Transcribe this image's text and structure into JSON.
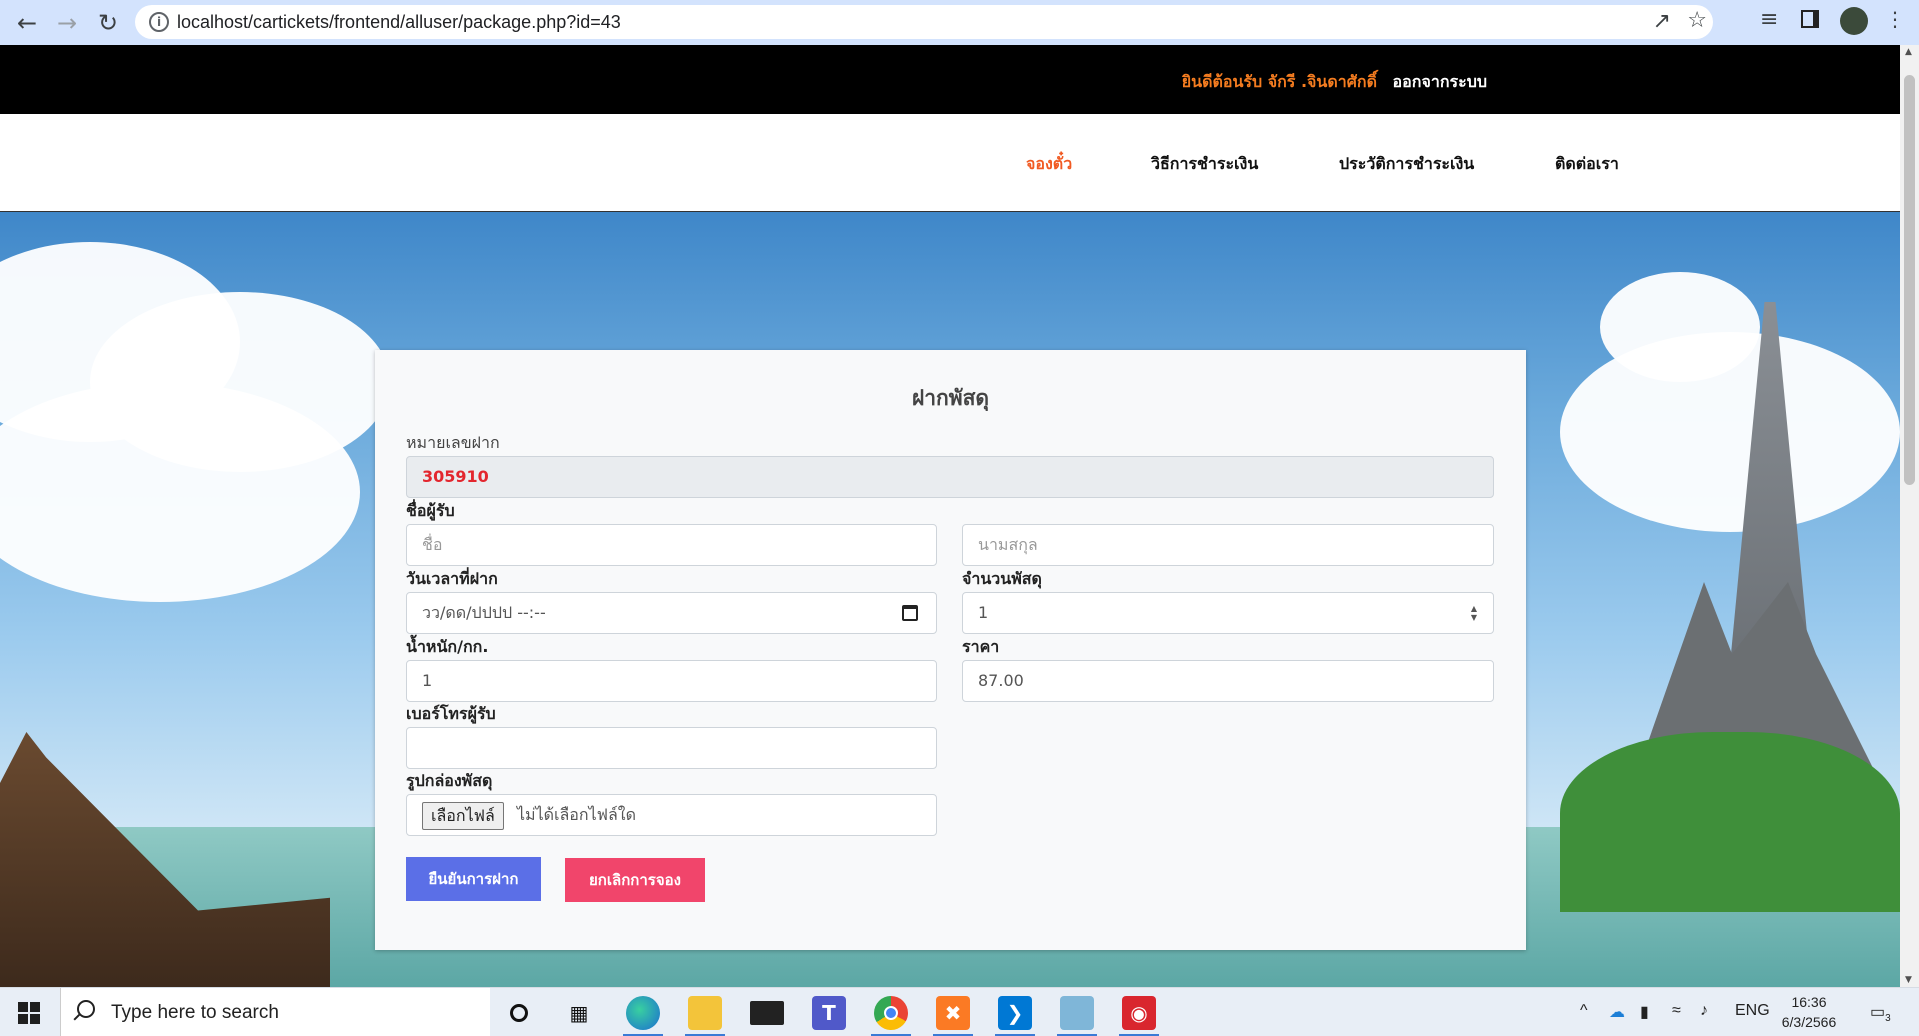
{
  "browser": {
    "url": "localhost/cartickets/frontend/alluser/package.php?id=43",
    "icons": [
      "back-icon",
      "forward-icon",
      "reload-icon",
      "info-icon",
      "share-icon",
      "star-icon",
      "reading-list-icon",
      "sidebar-icon",
      "profile-avatar"
    ]
  },
  "topbar": {
    "welcome": "ยินดีต้อนรับ จักรี .จินดาศักดิ์",
    "logout": "ออกจากระบบ"
  },
  "nav": {
    "items": [
      "จองตั๋ว",
      "วิธีการชำระเงิน",
      "ประวัติการชำระเงิน",
      "ติดต่อเรา"
    ],
    "active_color": "#f15a22"
  },
  "form": {
    "title": "ฝากพัสดุ",
    "tracking_label": "หมายเลขฝาก",
    "tracking_value": "305910",
    "recipient_label": "ชื่อผู้รับ",
    "first_name_placeholder": "ชื่อ",
    "last_name_placeholder": "นามสกุล",
    "datetime_label": "วันเวลาที่ฝาก",
    "datetime_placeholder": "วว/ดด/ปปปป --:--",
    "quantity_label": "จำนวนพัสดุ",
    "quantity_value": "1",
    "weight_label": "น้ำหนัก/กก.",
    "weight_value": "1",
    "price_label": "ราคา",
    "price_value": "87.00",
    "phone_label": "เบอร์โทรผู้รับ",
    "phone_value": "",
    "image_label": "รูปกล่องพัสดุ",
    "file_button": "เลือกไฟล์",
    "file_status": "ไม่ได้เลือกไฟล์ใด",
    "confirm_button": "ยืนยันการฝาก",
    "cancel_button": "ยกเลิกการจอง",
    "confirm_color": "#5b6fe7",
    "cancel_color": "#f1456b"
  },
  "taskbar": {
    "search_placeholder": "Type here to search",
    "language": "ENG",
    "time": "16:36",
    "date": "6/3/2566",
    "notification_count": "3",
    "apps": [
      "cortana-icon",
      "task-view-icon",
      "edge-icon",
      "file-explorer-icon",
      "mail-icon",
      "teams-icon",
      "chrome-icon",
      "xampp-icon",
      "vscode-icon",
      "app-icon",
      "camera-app-icon"
    ]
  }
}
